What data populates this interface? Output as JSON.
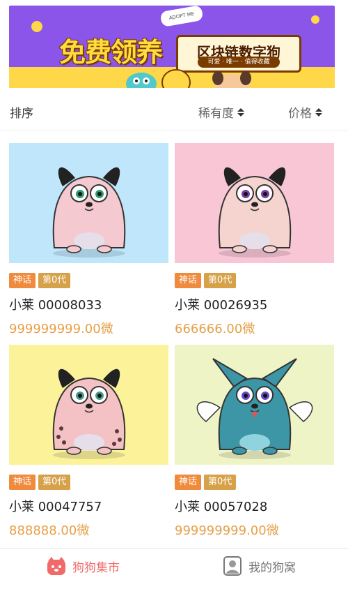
{
  "banner": {
    "title": "免费领养",
    "subtitle": "区块链数字狗",
    "tagline": "可爱 · 唯一 · 值得收藏",
    "badge": "ADOPT ME"
  },
  "sort": {
    "label": "排序",
    "rarity": "稀有度",
    "price": "价格"
  },
  "cards": [
    {
      "tag1": "神话",
      "tag2": "第0代",
      "name": "小莱 00008033",
      "price": "999999999.00微",
      "bg": "#bfe6fb",
      "body": "#f4c9cf"
    },
    {
      "tag1": "神话",
      "tag2": "第0代",
      "name": "小莱 00026935",
      "price": "666666.00微",
      "bg": "#f9c6d6",
      "body": "#f5d3cf"
    },
    {
      "tag1": "神话",
      "tag2": "第0代",
      "name": "小莱 00047757",
      "price": "888888.00微",
      "bg": "#fbf29a",
      "body": "#f4c2c4"
    },
    {
      "tag1": "神话",
      "tag2": "第0代",
      "name": "小莱 00057028",
      "price": "999999999.00微",
      "bg": "#eef4c6",
      "body": "#3d96a6"
    }
  ],
  "tabbar": {
    "market": "狗狗集市",
    "mine": "我的狗窝",
    "active_color": "#f06a6a"
  }
}
